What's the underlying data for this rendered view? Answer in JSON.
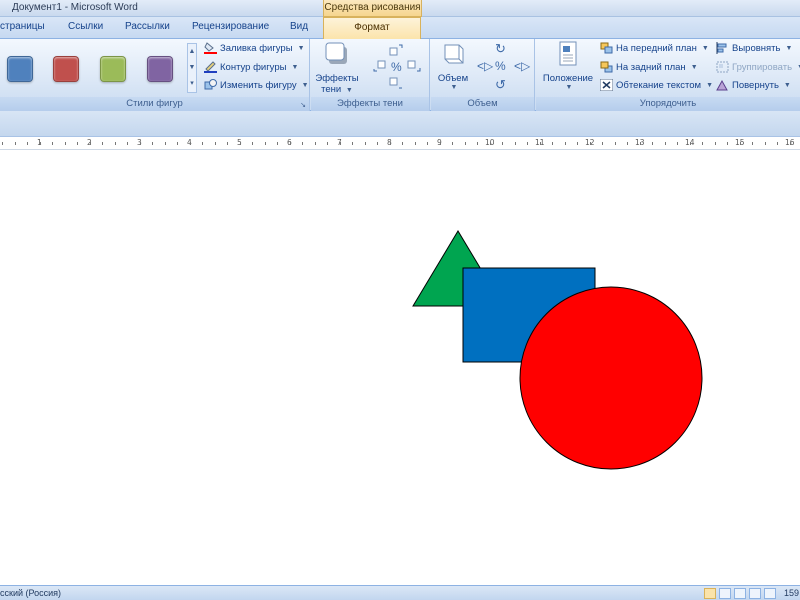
{
  "window": {
    "title": "Документ1 - Microsoft Word",
    "context_tools": "Средства рисования"
  },
  "tabs": [
    {
      "label": "страницы"
    },
    {
      "label": "Ссылки"
    },
    {
      "label": "Рассылки"
    },
    {
      "label": "Рецензирование"
    },
    {
      "label": "Вид"
    },
    {
      "label": "Формат",
      "active": true
    }
  ],
  "ribbon": {
    "shape_styles": {
      "label": "Стили фигур",
      "swatches": [
        "#4f81bd",
        "#c0504d",
        "#9bbb59",
        "#8064a2"
      ],
      "fill": "Заливка фигуры",
      "outline": "Контур фигуры",
      "change": "Изменить фигуру"
    },
    "shadow": {
      "label": "Эффекты тени",
      "button": "Эффекты тени",
      "button_line1": "Эффекты",
      "button_line2": "тени"
    },
    "volume": {
      "label": "Объем",
      "button": "Объем"
    },
    "arrange": {
      "label": "Упорядочить",
      "position": "Положение",
      "bring_front": "На передний план",
      "send_back": "На задний план",
      "wrap": "Обтекание текстом",
      "align": "Выровнять",
      "group": "Группировать",
      "rotate": "Повернуть"
    }
  },
  "ruler": {
    "labels": [
      "1",
      "2",
      "3",
      "4",
      "5",
      "6",
      "7",
      "8",
      "9",
      "10",
      "11",
      "12",
      "13",
      "14",
      "15",
      "16"
    ]
  },
  "document": {
    "shapes": [
      {
        "kind": "triangle",
        "color": "#00a550"
      },
      {
        "kind": "rectangle",
        "color": "#0070c0"
      },
      {
        "kind": "circle",
        "color": "#ff0000"
      }
    ]
  },
  "status": {
    "language": "сский (Россия)",
    "zoom": "159"
  }
}
